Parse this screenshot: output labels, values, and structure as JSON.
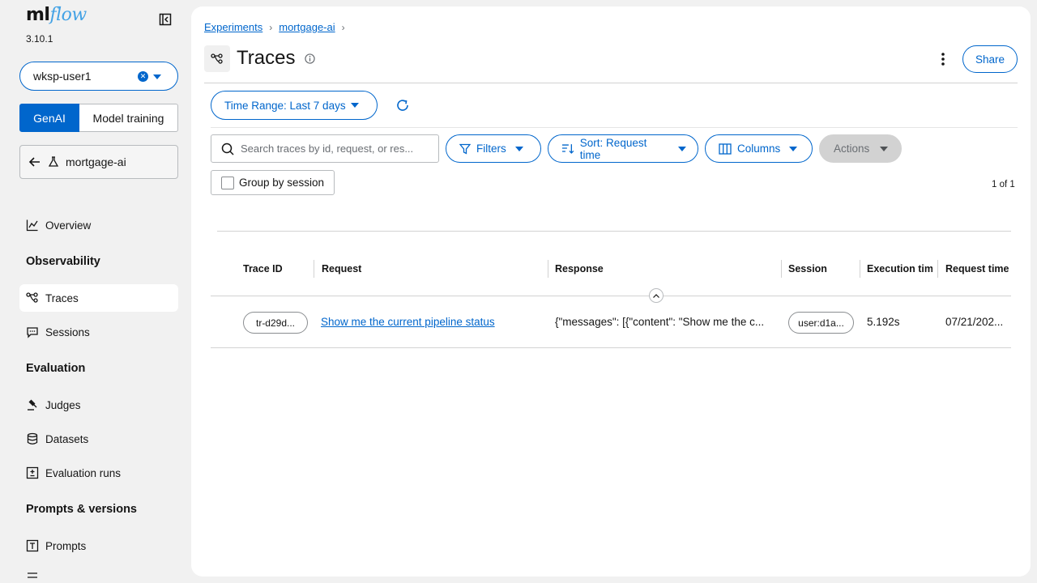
{
  "app": {
    "logo_ml": "ml",
    "logo_flow": "flow",
    "version": "3.10.1"
  },
  "sidebar": {
    "workspace": "wksp-user1",
    "toggle": {
      "genai": "GenAI",
      "model_training": "Model training"
    },
    "experiment": "mortgage-ai",
    "sections": {
      "observability": "Observability",
      "evaluation": "Evaluation",
      "prompts": "Prompts & versions"
    },
    "items": {
      "overview": "Overview",
      "traces": "Traces",
      "sessions": "Sessions",
      "judges": "Judges",
      "datasets": "Datasets",
      "evaluation_runs": "Evaluation runs",
      "prompts": "Prompts"
    }
  },
  "breadcrumb": {
    "experiments": "Experiments",
    "experiment": "mortgage-ai"
  },
  "header": {
    "title": "Traces",
    "share": "Share"
  },
  "toolbar": {
    "time_range": "Time Range: Last 7 days",
    "search_placeholder": "Search traces by id, request, or res...",
    "filters": "Filters",
    "sort": "Sort: Request time",
    "columns": "Columns",
    "actions": "Actions",
    "group_by_session": "Group by session",
    "pagination": "1 of 1"
  },
  "table": {
    "headers": {
      "trace_id": "Trace ID",
      "request": "Request",
      "response": "Response",
      "session": "Session",
      "execution_time": "Execution time",
      "request_time": "Request time"
    },
    "rows": [
      {
        "trace_id": "tr-d29d...",
        "request": "Show me the current pipeline status",
        "response": "{\"messages\": [{\"content\": \"Show me the c...",
        "session": "user:d1a...",
        "execution_time": "5.192s",
        "request_time": "07/21/202..."
      }
    ]
  },
  "colors": {
    "accent": "#0066cc",
    "logo_flow": "#43a2e5"
  }
}
